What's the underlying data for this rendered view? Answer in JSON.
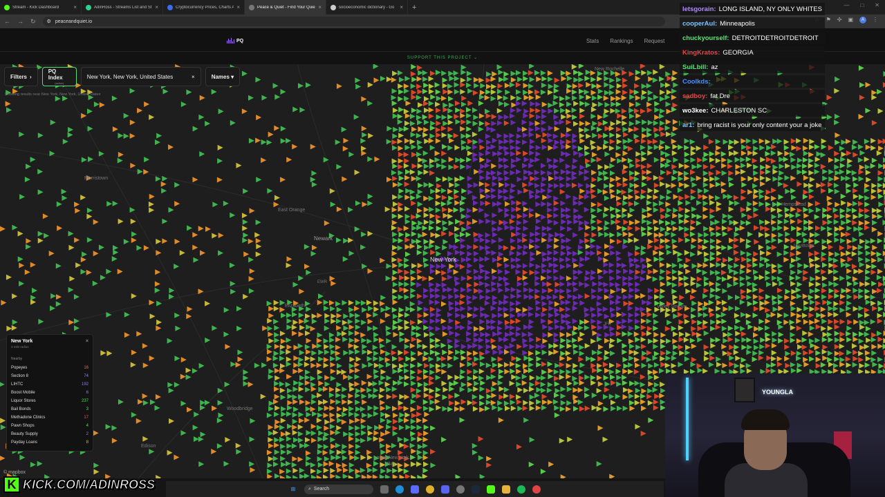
{
  "browser": {
    "tabs": [
      {
        "title": "Stream - Kick Dashboard",
        "color": "#53fc18"
      },
      {
        "title": "AdinRoss - Streams List and St",
        "color": "#2fd08a"
      },
      {
        "title": "Cryptocurrency Prices, Charts A",
        "color": "#3a6df0"
      },
      {
        "title": "Peace & Quiet - Find Your Quie",
        "color": "#777777"
      },
      {
        "title": "socioeconomic dictionary - Go",
        "color": "#cccccc"
      }
    ],
    "url": "peaceandquiet.io"
  },
  "site": {
    "logo_text": "PQ",
    "nav": [
      "Stats",
      "Rankings",
      "Request"
    ],
    "support_banner": "SUPPORT THIS PROJECT ⌄"
  },
  "filters": {
    "filters_label": "Filters",
    "pq_index_label": "PQ Index",
    "pq_index_sub": "(active)",
    "location_value": "New York, New York, United States",
    "names_label": "Names ▾",
    "showing_text": "Showing results near New York, New York, United States"
  },
  "map": {
    "places": {
      "morristown": "Morristown",
      "east_orange": "East Orange",
      "newark": "Newark",
      "new_york": "New York",
      "ewr": "EWR",
      "elizabeth": "Elizabeth",
      "woodbridge": "Woodbridge",
      "new_rochelle": "New Rochelle",
      "jfk": "JFK",
      "edison": "Edison",
      "lower_ny_bay": "Lower New York Bay",
      "hempstead": "Hempstead",
      "levittown": "Levittown",
      "valley_stream": "Valley Stream"
    },
    "attribution": "© mapbox"
  },
  "panel": {
    "title": "New York",
    "subtitle": "3 mile radius",
    "nearby_label": "Nearby",
    "rows": [
      {
        "label": "Popeyes",
        "value": "16",
        "color": "#ff5c5c"
      },
      {
        "label": "Section 8",
        "value": "74",
        "color": "#9a7bff"
      },
      {
        "label": "LIHTC",
        "value": "192",
        "color": "#9a7bff"
      },
      {
        "label": "Boost Mobile",
        "value": "6",
        "color": "#9a7bff"
      },
      {
        "label": "Liquor Stores",
        "value": "237",
        "color": "#52e05a"
      },
      {
        "label": "Bail Bonds",
        "value": "3",
        "color": "#52e05a"
      },
      {
        "label": "Methadone Clinics",
        "value": "17",
        "color": "#ff5c5c"
      },
      {
        "label": "Pawn Shops",
        "value": "4",
        "color": "#52e05a"
      },
      {
        "label": "Beauty Supply",
        "value": "2",
        "color": "#9a7bff"
      },
      {
        "label": "Payday Loans",
        "value": "8",
        "color": "#f2b01e"
      }
    ]
  },
  "chat": [
    {
      "user": "letsgorain:",
      "text": "LONG ISLAND, NY ONLY WHITES",
      "color": "#b08cff"
    },
    {
      "user": "cooperAul:",
      "text": "Minneapolis",
      "color": "#7fc3ff"
    },
    {
      "user": "chuckyourself:",
      "text": "DETROITDETROITDETROIT",
      "color": "#5be07a"
    },
    {
      "user": "KingKratos:",
      "text": "GEORGIA",
      "color": "#e04a4a"
    },
    {
      "user": "SuiLbill:",
      "text": "az",
      "color": "#5be07a"
    },
    {
      "user": "Coolkds:",
      "text": "",
      "color": "#4f8fff"
    },
    {
      "user": "sadboy:",
      "text": "fat Dre",
      "color": "#e04a4a"
    },
    {
      "user": "wo3kee:",
      "text": "CHARLESTON SC",
      "color": "#ffffff"
    },
    {
      "user": "ar1:",
      "text": "bring racist is your only content your a joke",
      "color": "#7fc3ff"
    }
  ],
  "webcam": {
    "sign_text": "YOUNGLA"
  },
  "branding": {
    "kick_url": "KICK.COM/ADINROSS"
  },
  "taskbar": {
    "search_label": "Search"
  }
}
